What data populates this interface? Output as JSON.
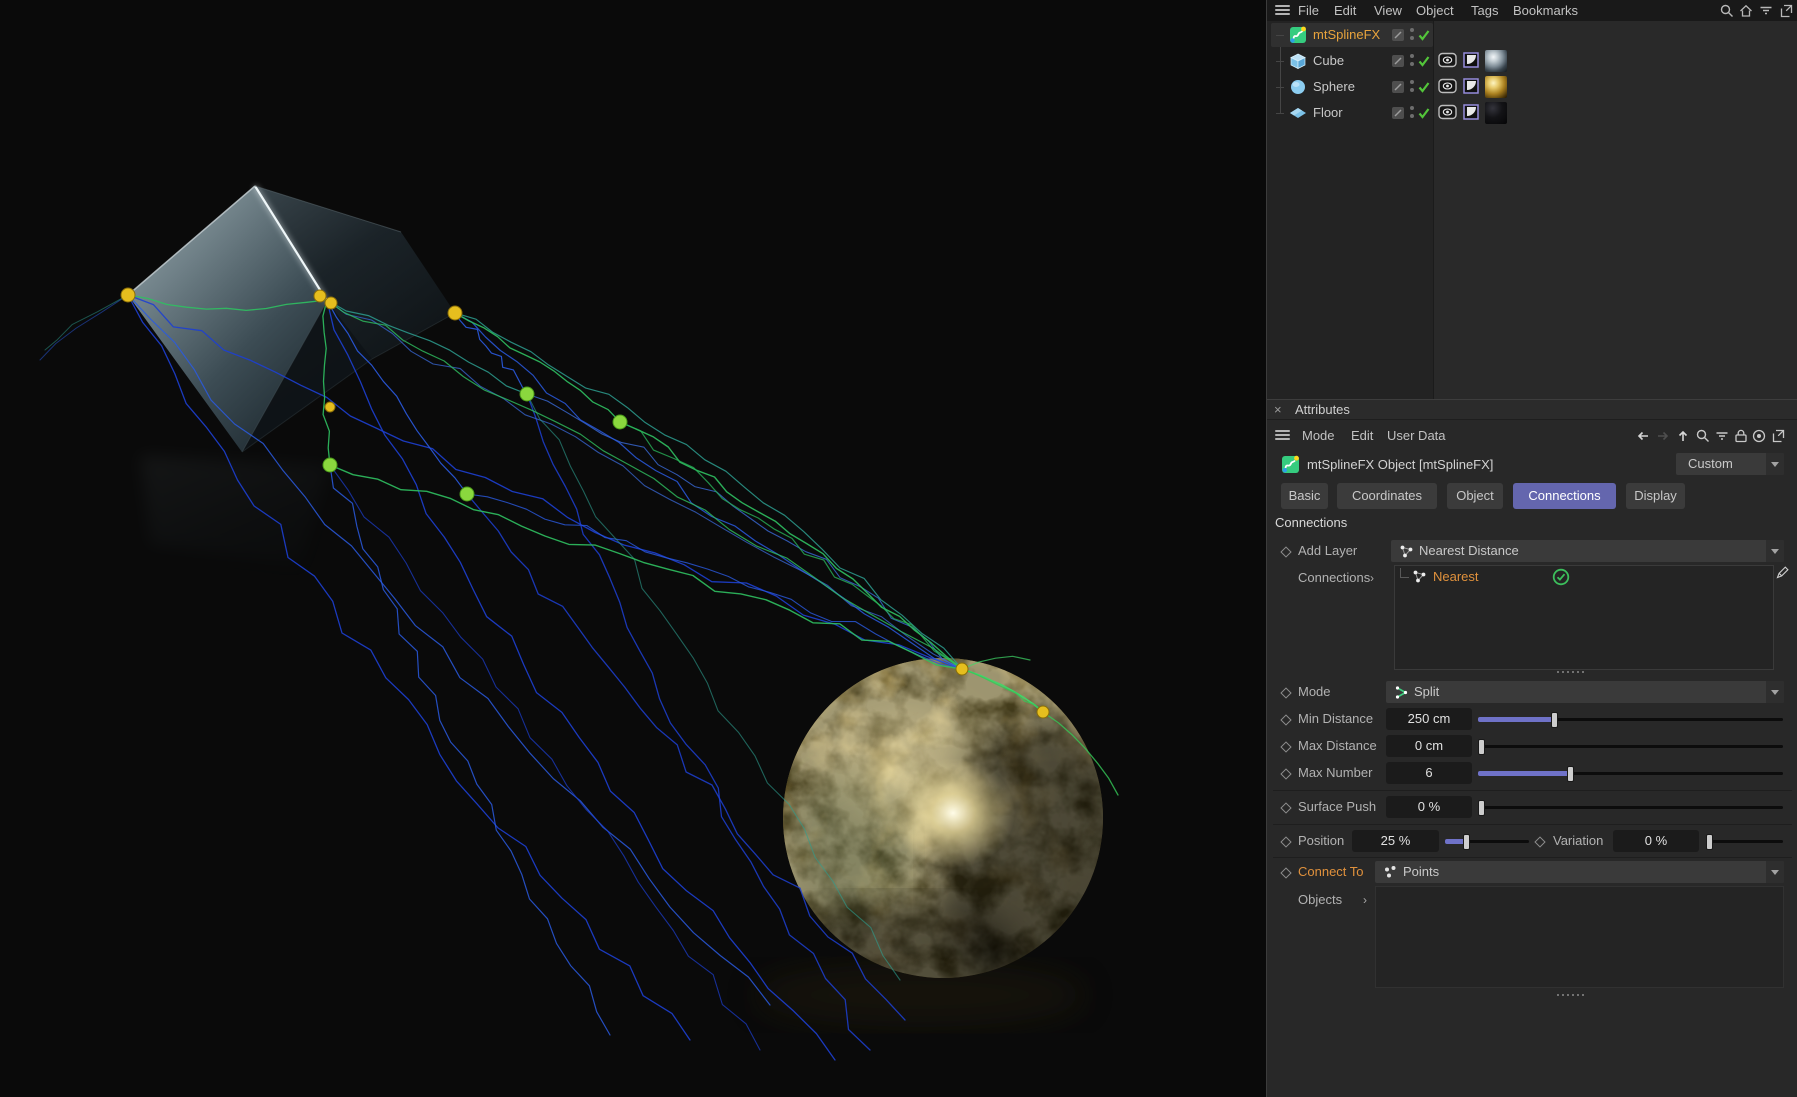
{
  "object_manager": {
    "menu_items": [
      "File",
      "Edit",
      "View",
      "Object",
      "Tags",
      "Bookmarks"
    ],
    "toolbar_icons": [
      "search-icon",
      "home-icon",
      "filter-icon",
      "new-window-icon"
    ],
    "objects": [
      {
        "name": "mtSplineFX",
        "type": "splinefx-generator",
        "selected": true,
        "enabled": true
      },
      {
        "name": "Cube",
        "type": "cube",
        "enabled": true,
        "visible": true,
        "phong_tag": true,
        "material": "silver"
      },
      {
        "name": "Sphere",
        "type": "sphere",
        "enabled": true,
        "visible": true,
        "phong_tag": true,
        "material": "gold"
      },
      {
        "name": "Floor",
        "type": "floor",
        "enabled": true,
        "visible": true,
        "phong_tag": true,
        "material": "black"
      }
    ]
  },
  "attributes_panel": {
    "close_label": "×",
    "title": "Attributes",
    "menu_items": [
      "Mode",
      "Edit",
      "User Data"
    ],
    "toolbar_icons": [
      "arrow-left-icon",
      "arrow-right-icon",
      "arrow-up-icon",
      "search-icon",
      "filter-icon",
      "lock-icon",
      "target-icon",
      "new-window-icon"
    ],
    "object_title": "mtSplineFX Object [mtSplineFX]",
    "preset_dropdown": "Custom",
    "tabs": [
      {
        "label": "Basic",
        "selected": false
      },
      {
        "label": "Coordinates",
        "selected": false
      },
      {
        "label": "Object",
        "selected": false
      },
      {
        "label": "Connections",
        "selected": true
      },
      {
        "label": "Display",
        "selected": false
      }
    ],
    "section_title": "Connections",
    "add_layer": {
      "label": "Add Layer",
      "value": "Nearest Distance"
    },
    "connections_list": {
      "label": "Connections",
      "items": [
        {
          "name": "Nearest",
          "enabled": true
        }
      ]
    },
    "mode": {
      "label": "Mode",
      "value": "Split"
    },
    "min_distance": {
      "label": "Min Distance",
      "value": "250 cm",
      "fill_percent": 25
    },
    "max_distance": {
      "label": "Max Distance",
      "value": "0 cm",
      "fill_percent": 0
    },
    "max_number": {
      "label": "Max Number",
      "value": "6",
      "fill_percent": 30
    },
    "surface_push": {
      "label": "Surface Push",
      "value": "0 %",
      "fill_percent": 0
    },
    "position": {
      "label": "Position",
      "value": "25 %",
      "fill_percent": 25
    },
    "variation": {
      "label": "Variation",
      "value": "0 %",
      "fill_percent": 0
    },
    "connect_to": {
      "label": "Connect To",
      "value": "Points"
    },
    "objects_field": {
      "label": "Objects"
    }
  },
  "colors": {
    "selected_tab": "#6466ae",
    "slider_fill": "#6f72c8",
    "highlight_text": "#e8973d",
    "selected_object_text": "#e8a33c",
    "check_green": "#53c53a",
    "spline_blue": "#1d3fd2",
    "spline_green": "#2fc060",
    "spline_teal": "#2d9e8f",
    "point_yellow": "#e6be1e",
    "point_green": "#8ad83e"
  }
}
